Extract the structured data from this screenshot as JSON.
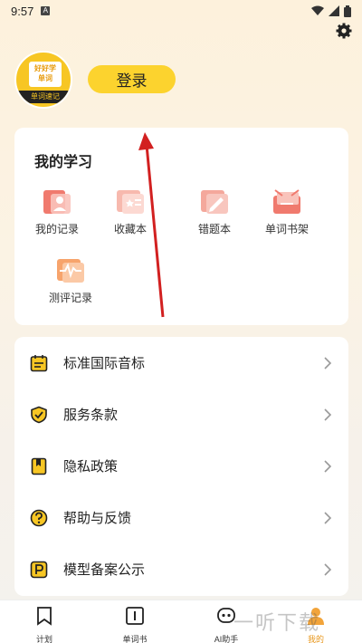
{
  "status_bar": {
    "time": "9:57",
    "notification_icon": "A"
  },
  "profile": {
    "avatar_top_text": "好好学\n单词",
    "avatar_bottom_text": "单词速记",
    "login_label": "登录"
  },
  "study": {
    "title": "我的学习",
    "items": [
      {
        "label": "我的记录",
        "icon": "record-icon"
      },
      {
        "label": "收藏本",
        "icon": "favorites-icon"
      },
      {
        "label": "错题本",
        "icon": "wrong-questions-icon"
      },
      {
        "label": "单词书架",
        "icon": "bookshelf-icon"
      },
      {
        "label": "测评记录",
        "icon": "assessment-icon"
      }
    ]
  },
  "menu": [
    {
      "label": "标准国际音标",
      "icon": "calendar-icon"
    },
    {
      "label": "服务条款",
      "icon": "shield-check-icon"
    },
    {
      "label": "隐私政策",
      "icon": "bookmark-book-icon"
    },
    {
      "label": "帮助与反馈",
      "icon": "help-icon"
    },
    {
      "label": "模型备案公示",
      "icon": "p-badge-icon"
    }
  ],
  "bottom_nav": [
    {
      "label": "计划",
      "icon": "plan-icon",
      "active": false
    },
    {
      "label": "单词书",
      "icon": "wordbook-icon",
      "active": false
    },
    {
      "label": "AI助手",
      "icon": "ai-robot-icon",
      "active": false
    },
    {
      "label": "我的",
      "icon": "profile-icon",
      "active": true
    }
  ],
  "watermark": "一听下载",
  "colors": {
    "accent": "#fcd32e",
    "icon_orange": "#f2a43a",
    "icon_red": "#f07a6e",
    "active_nav": "#e8961a",
    "arrow": "#d22020"
  }
}
